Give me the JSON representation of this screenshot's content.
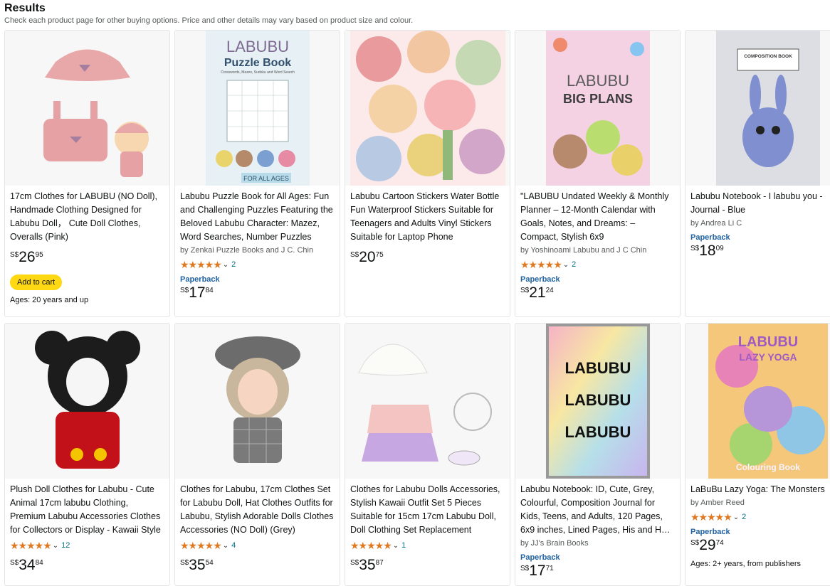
{
  "header": {
    "title": "Results",
    "subtitle": "Check each product page for other buying options. Price and other details may vary based on product size and colour."
  },
  "products": [
    {
      "title": "17cm Clothes for LABUBU (NO Doll), Handmade Clothing Designed for Labubu Doll， Cute Doll Clothes, Overalls (Pink)",
      "price": {
        "currency": "S$",
        "whole": "26",
        "fraction": "95"
      },
      "button": "Add to cart",
      "note": "Ages: 20 years and up"
    },
    {
      "title": "Labubu Puzzle Book for All Ages: Fun and Challenging Puzzles Featuring the Beloved Labubu Character: Mazez, Word Searches, Number Puzzles",
      "author": "by Zenkai Puzzle Books and J C. Chin",
      "stars": "★★★★★",
      "reviews": "2",
      "format": "Paperback",
      "price": {
        "currency": "S$",
        "whole": "17",
        "fraction": "84"
      },
      "cover_title": "LABUBU",
      "cover_sub": "Puzzle Book",
      "cover_small": "Crosswords, Mazes, Sudoku and Word Search",
      "cover_bottom": "FOR ALL AGES"
    },
    {
      "title": "Labubu Cartoon Stickers Water Bottle Fun Waterproof Stickers Suitable for Teenagers and Adults Vinyl Stickers Suitable for Laptop Phone",
      "price": {
        "currency": "S$",
        "whole": "20",
        "fraction": "75"
      }
    },
    {
      "title": "\"LABUBU Undated Weekly & Monthly Planner – 12-Month Calendar with Goals, Notes, and Dreams: – Compact, Stylish 6x9",
      "author": "by Yoshinoami Labubu and J C Chin",
      "stars": "★★★★★",
      "reviews": "2",
      "format": "Paperback",
      "price": {
        "currency": "S$",
        "whole": "21",
        "fraction": "24"
      },
      "cover_title": "LABUBU",
      "cover_sub": "BIG PLANS"
    },
    {
      "title": "Labubu Notebook - I labubu you - Journal - Blue",
      "author": "by Andrea Li C",
      "format": "Paperback",
      "price": {
        "currency": "S$",
        "whole": "18",
        "fraction": "09"
      },
      "cover_label": "COMPOSITION BOOK"
    },
    {
      "title": "Plush Doll Clothes for Labubu - Cute Animal 17cm labubu Clothing, Premium Labubu Accessories Clothes for Collectors or Display - Kawaii Style",
      "stars": "★★★★★",
      "reviews": "12",
      "price": {
        "currency": "S$",
        "whole": "34",
        "fraction": "84"
      }
    },
    {
      "title": "Clothes for Labubu, 17cm Clothes Set for Labubu Doll, Hat Clothes Outfits for Labubu, Stylish Adorable Dolls Clothes Accessories (NO Doll) (Grey)",
      "stars": "★★★★★",
      "reviews": "4",
      "price": {
        "currency": "S$",
        "whole": "35",
        "fraction": "54"
      }
    },
    {
      "title": "Clothes for Labubu Dolls Accessories, Stylish Kawaii Outfit Set 5 Pieces Suitable for 15cm 17cm Labubu Doll, Doll Clothing Set Replacement",
      "stars": "★★★★★",
      "reviews": "1",
      "price": {
        "currency": "S$",
        "whole": "35",
        "fraction": "87"
      }
    },
    {
      "title": "Labubu Notebook: ID, Cute, Grey, Colourful, Composition Journal for Kids, Teens, and Adults, 120 Pages, 6x9 inches, Lined Pages, His and Hers Notebook",
      "author": "by JJ's Brain Books",
      "format": "Paperback",
      "price": {
        "currency": "S$",
        "whole": "17",
        "fraction": "71"
      },
      "cover_word": "LABUBU"
    },
    {
      "title": "LaBuBu Lazy Yoga: The Monsters",
      "author": "by Amber Reed",
      "stars": "★★★★★",
      "reviews": "2",
      "format": "Paperback",
      "price": {
        "currency": "S$",
        "whole": "29",
        "fraction": "74"
      },
      "note": "Ages: 2+ years, from publishers",
      "cover_title": "LABUBU",
      "cover_sub": "LAZY YOGA",
      "cover_bottom": "Colouring Book"
    }
  ],
  "colors": {
    "star": "#de7921",
    "link": "#007185",
    "format": "#2162a1",
    "cart": "#ffd814"
  },
  "icons": {
    "chevron": "chevron-down-icon"
  }
}
